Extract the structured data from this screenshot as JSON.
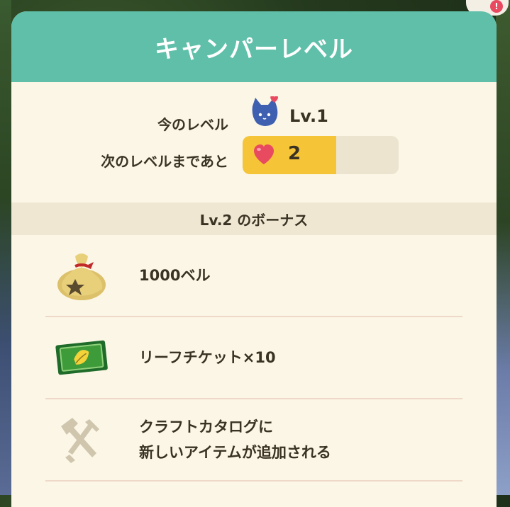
{
  "window": {
    "title": "キャンパーレベル"
  },
  "level": {
    "current_label": "今のレベル",
    "current_value": "Lv.1",
    "next_label": "次のレベルまであと",
    "remaining": "2",
    "progress_fraction": 0.6,
    "icon": "blue-cat-icon"
  },
  "bonus": {
    "heading": "Lv.2 のボーナス",
    "items": [
      {
        "icon": "bell-bag-icon",
        "label": "1000ベル"
      },
      {
        "icon": "leaf-ticket-icon",
        "label": "リーフチケット×10"
      },
      {
        "icon": "craft-tools-icon",
        "line1": "クラフトカタログに",
        "line2": "新しいアイテムが追加される"
      }
    ]
  },
  "colors": {
    "header": "#5fbfa9",
    "panel": "#fbf6e6",
    "progress_fill": "#f6c437",
    "heart": "#e84a5f"
  }
}
